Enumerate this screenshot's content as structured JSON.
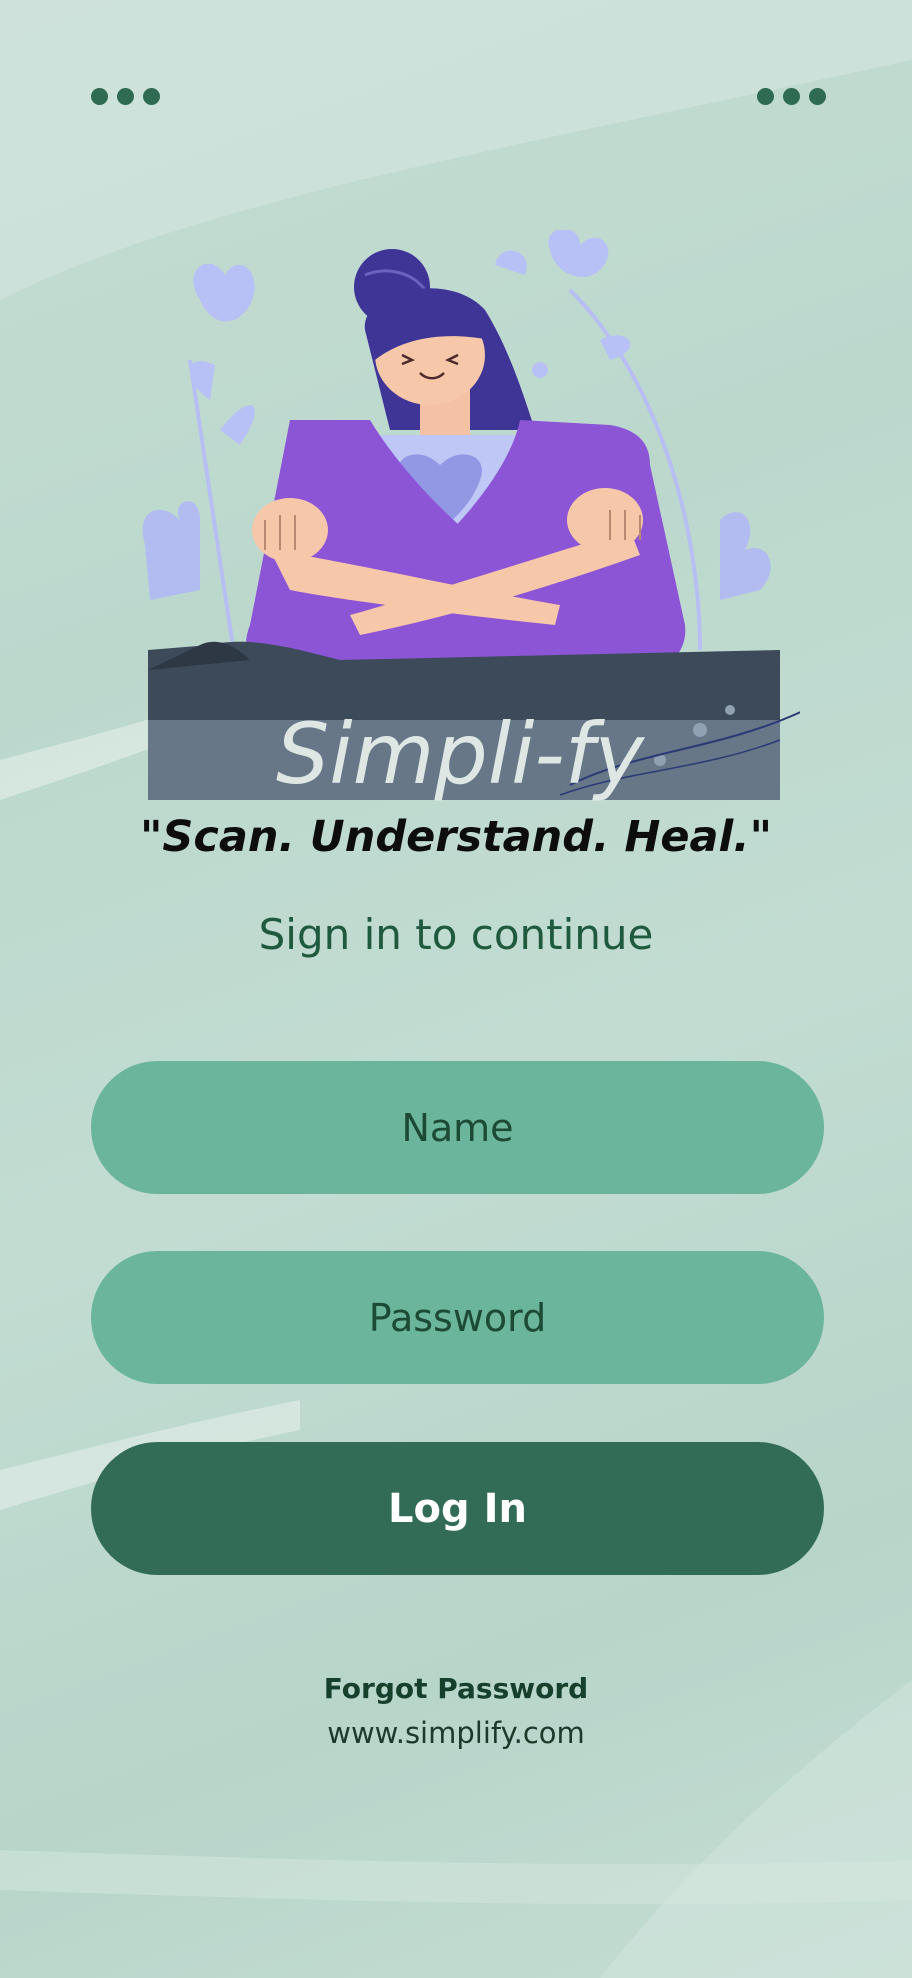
{
  "app": {
    "brand_name": "Simpli-fy",
    "tagline": "\"Scan. Understand. Heal.\"",
    "subtitle": "Sign in to continue"
  },
  "form": {
    "name_placeholder": "Name",
    "password_placeholder": "Password",
    "login_label": "Log In"
  },
  "footer": {
    "forgot_password": "Forgot Password",
    "website": "www.simplify.com"
  },
  "icons": {
    "left_menu": "more-dots-icon",
    "right_menu": "more-dots-icon"
  },
  "colors": {
    "background": "#c2dcd2",
    "input_fill": "#6bb59c",
    "button_fill": "#336c56",
    "text_dark_green": "#1f5a3f",
    "illustration_purple": "#8b55d6"
  }
}
